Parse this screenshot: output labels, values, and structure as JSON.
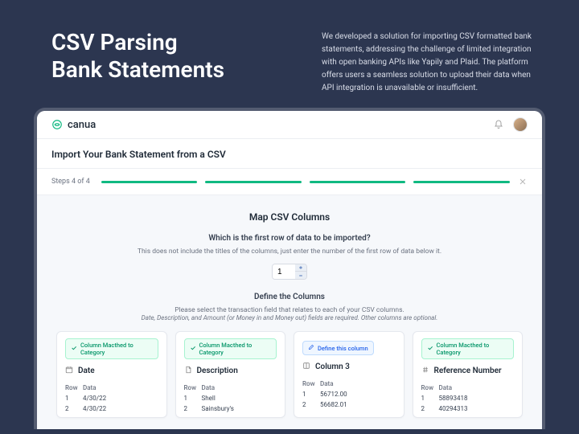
{
  "hero": {
    "title_l1": "CSV Parsing",
    "title_l2": "Bank Statements",
    "body": "We developed a solution for importing CSV formatted bank statements, addressing the challenge of limited integration with open banking APIs like Yapily and Plaid.  The platform offers users a seamless solution to upload their data when API integration is unavailable or insufficient."
  },
  "brand": {
    "name": "canua"
  },
  "page": {
    "title": "Import Your Bank Statement from a CSV"
  },
  "steps": {
    "label": "Steps 4 of 4",
    "count": 4,
    "completed": 4
  },
  "section": {
    "title": "Map CSV Columns",
    "first_row_q": "Which is the first row of data to be imported?",
    "first_row_hint": "This does not include the titles of the columns, just enter the number of the first row of data below it.",
    "first_row_value": "1",
    "define_title": "Define the Columns",
    "define_l1": "Please select the transaction field that relates to each of your CSV columns.",
    "define_l2": "Date, Description, and Amount (or Money in and Money out) fields are required. Other columns are optional."
  },
  "tags": {
    "matched": "Column Macthed to Category",
    "define": "Define this column"
  },
  "table_head": {
    "row": "Row",
    "data": "Data"
  },
  "columns": [
    {
      "status": "matched",
      "title": "Date",
      "icon": "calendar-icon",
      "rows": [
        {
          "row": "1",
          "data": "4/30/22"
        },
        {
          "row": "2",
          "data": "4/30/22"
        }
      ]
    },
    {
      "status": "matched",
      "title": "Description",
      "icon": "document-icon",
      "rows": [
        {
          "row": "1",
          "data": "Shell"
        },
        {
          "row": "2",
          "data": "Sainsbury's"
        }
      ]
    },
    {
      "status": "define",
      "title": "Column 3",
      "icon": "column-icon",
      "rows": [
        {
          "row": "1",
          "data": "56712.00"
        },
        {
          "row": "2",
          "data": "56682.01"
        }
      ]
    },
    {
      "status": "matched",
      "title": "Reference Number",
      "icon": "hash-icon",
      "rows": [
        {
          "row": "1",
          "data": "58893418"
        },
        {
          "row": "2",
          "data": "40294313"
        }
      ]
    }
  ]
}
